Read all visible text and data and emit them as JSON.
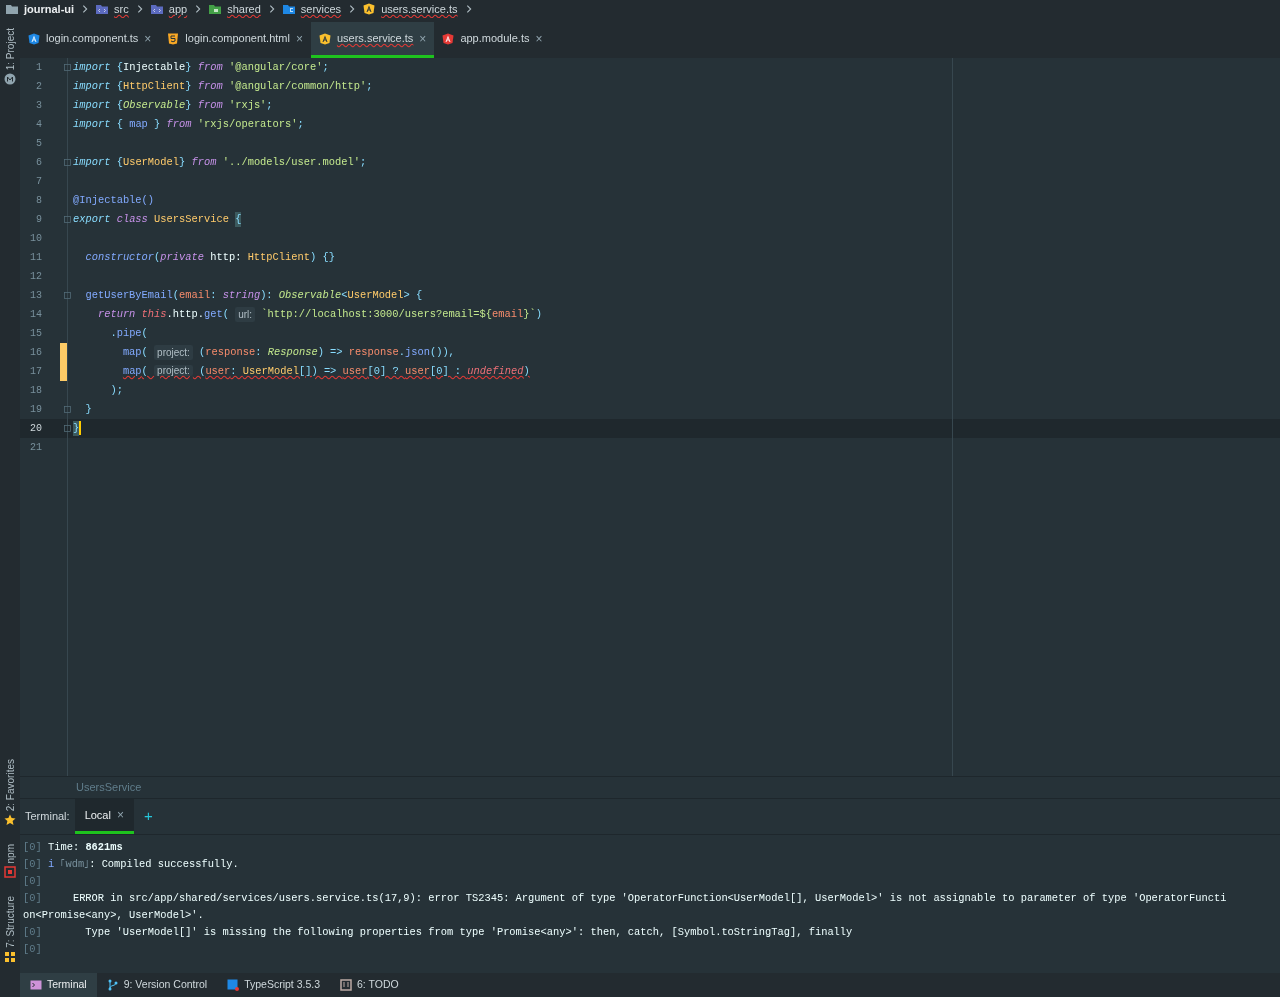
{
  "breadcrumb": [
    {
      "kind": "folder",
      "label": "journal-ui",
      "bold": true,
      "error": false
    },
    {
      "kind": "src-folder",
      "label": "src",
      "bold": false,
      "error": true
    },
    {
      "kind": "src-folder",
      "label": "app",
      "bold": false,
      "error": true
    },
    {
      "kind": "green-folder",
      "label": "shared",
      "bold": false,
      "error": true
    },
    {
      "kind": "blue-folder",
      "label": "services",
      "bold": false,
      "error": true
    },
    {
      "kind": "angular-yellow",
      "label": "users.service.ts",
      "bold": false,
      "error": true
    }
  ],
  "side_tools_top": [
    {
      "label": "1: Project",
      "kind": "project"
    }
  ],
  "side_tools_bottom": [
    {
      "label": "2: Favorites",
      "kind": "star"
    },
    {
      "label": "npm",
      "kind": "npm"
    },
    {
      "label": "7: Structure",
      "kind": "structure"
    }
  ],
  "tabs": [
    {
      "kind": "angular-blue",
      "label": "login.component.ts",
      "selected": false,
      "error": false
    },
    {
      "kind": "html",
      "label": "login.component.html",
      "selected": false,
      "error": false
    },
    {
      "kind": "angular-yellow",
      "label": "users.service.ts",
      "selected": true,
      "error": true
    },
    {
      "kind": "angular-red",
      "label": "app.module.ts",
      "selected": false,
      "error": false
    }
  ],
  "close_glyph": "×",
  "code": [
    {
      "number": "1",
      "fold": true,
      "changed": false,
      "current": false,
      "tokens": [
        {
          "text": "import",
          "kind": "kwb"
        },
        {
          "text": " {",
          "kind": "p"
        },
        {
          "text": "Injectable",
          "kind": "id"
        },
        {
          "text": "} ",
          "kind": "p"
        },
        {
          "text": "from",
          "kind": "kwp"
        },
        {
          "text": " '@angular/core'",
          "kind": "str"
        },
        {
          "text": ";",
          "kind": "p"
        }
      ]
    },
    {
      "number": "2",
      "fold": false,
      "changed": false,
      "current": false,
      "tokens": [
        {
          "text": "import",
          "kind": "kwb"
        },
        {
          "text": " {",
          "kind": "p"
        },
        {
          "text": "HttpClient",
          "kind": "cls"
        },
        {
          "text": "} ",
          "kind": "p"
        },
        {
          "text": "from",
          "kind": "kwp"
        },
        {
          "text": " '@angular/common/http'",
          "kind": "str"
        },
        {
          "text": ";",
          "kind": "p"
        }
      ]
    },
    {
      "number": "3",
      "fold": false,
      "changed": false,
      "current": false,
      "tokens": [
        {
          "text": "import",
          "kind": "kwb"
        },
        {
          "text": " {",
          "kind": "p"
        },
        {
          "text": "Observable",
          "kind": "iface"
        },
        {
          "text": "} ",
          "kind": "p"
        },
        {
          "text": "from",
          "kind": "kwp"
        },
        {
          "text": " 'rxjs'",
          "kind": "str"
        },
        {
          "text": ";",
          "kind": "p"
        }
      ]
    },
    {
      "number": "4",
      "fold": false,
      "changed": false,
      "current": false,
      "tokens": [
        {
          "text": "import",
          "kind": "kwb"
        },
        {
          "text": " { ",
          "kind": "p"
        },
        {
          "text": "map",
          "kind": "fn"
        },
        {
          "text": " } ",
          "kind": "p"
        },
        {
          "text": "from",
          "kind": "kwp"
        },
        {
          "text": " 'rxjs/operators'",
          "kind": "str"
        },
        {
          "text": ";",
          "kind": "p"
        }
      ]
    },
    {
      "number": "5",
      "fold": false,
      "changed": false,
      "current": false
    },
    {
      "number": "6",
      "fold": true,
      "changed": false,
      "current": false,
      "tokens": [
        {
          "text": "import",
          "kind": "kwb"
        },
        {
          "text": " {",
          "kind": "p"
        },
        {
          "text": "UserModel",
          "kind": "cls"
        },
        {
          "text": "} ",
          "kind": "p"
        },
        {
          "text": "from",
          "kind": "kwp"
        },
        {
          "text": " '../models/user.model'",
          "kind": "str"
        },
        {
          "text": ";",
          "kind": "p"
        }
      ]
    },
    {
      "number": "7",
      "fold": false,
      "changed": false,
      "current": false
    },
    {
      "number": "8",
      "fold": false,
      "changed": false,
      "current": false,
      "tokens": [
        {
          "text": "@Injectable()",
          "kind": "dec"
        }
      ]
    },
    {
      "number": "9",
      "fold": true,
      "changed": false,
      "current": false,
      "tokens": [
        {
          "text": "export ",
          "kind": "kwb"
        },
        {
          "text": "class ",
          "kind": "kwp"
        },
        {
          "text": "UsersService ",
          "kind": "cls"
        },
        {
          "text": "{",
          "kind": "brace"
        }
      ]
    },
    {
      "number": "10",
      "fold": false,
      "changed": false,
      "current": false
    },
    {
      "number": "11",
      "fold": false,
      "changed": false,
      "current": false,
      "tokens": [
        {
          "text": "  constructor",
          "kind": "fni"
        },
        {
          "text": "(",
          "kind": "p"
        },
        {
          "text": "private",
          "kind": "kwp"
        },
        {
          "text": " http: ",
          "kind": "id"
        },
        {
          "text": "HttpClient",
          "kind": "cls"
        },
        {
          "text": ") {}",
          "kind": "p"
        }
      ]
    },
    {
      "number": "12",
      "fold": false,
      "changed": false,
      "current": false
    },
    {
      "number": "13",
      "fold": true,
      "changed": false,
      "current": false,
      "tokens": [
        {
          "text": "  getUserByEmail",
          "kind": "fn"
        },
        {
          "text": "(",
          "kind": "p"
        },
        {
          "text": "email",
          "kind": "param"
        },
        {
          "text": ": ",
          "kind": "p"
        },
        {
          "text": "string",
          "kind": "kwp"
        },
        {
          "text": "): ",
          "kind": "p"
        },
        {
          "text": "Observable",
          "kind": "iface"
        },
        {
          "text": "<",
          "kind": "p"
        },
        {
          "text": "UserModel",
          "kind": "cls"
        },
        {
          "text": "> {",
          "kind": "p"
        }
      ]
    },
    {
      "number": "14",
      "fold": false,
      "changed": false,
      "current": false,
      "tokens": [
        {
          "text": "    return ",
          "kind": "kwp"
        },
        {
          "text": "this",
          "kind": "kwr"
        },
        {
          "text": ".http.",
          "kind": "id"
        },
        {
          "text": "get",
          "kind": "fn"
        },
        {
          "text": "( ",
          "kind": "p"
        },
        {
          "text": "url:",
          "kind": "hint"
        },
        {
          "text": " `http://localhost:3000/users?email=${",
          "kind": "str"
        },
        {
          "text": "email",
          "kind": "param"
        },
        {
          "text": "}`",
          "kind": "str"
        },
        {
          "text": ")",
          "kind": "p"
        }
      ]
    },
    {
      "number": "15",
      "fold": false,
      "changed": false,
      "current": false,
      "tokens": [
        {
          "text": "      .",
          "kind": "p"
        },
        {
          "text": "pipe",
          "kind": "fn"
        },
        {
          "text": "(",
          "kind": "p"
        }
      ]
    },
    {
      "number": "16",
      "fold": false,
      "changed": true,
      "current": false,
      "tokens": [
        {
          "text": "        map",
          "kind": "fn"
        },
        {
          "text": "( ",
          "kind": "p"
        },
        {
          "text": "project:",
          "kind": "hint"
        },
        {
          "text": " (",
          "kind": "p"
        },
        {
          "text": "response",
          "kind": "param"
        },
        {
          "text": ": ",
          "kind": "p"
        },
        {
          "text": "Response",
          "kind": "iface"
        },
        {
          "text": ") => ",
          "kind": "p"
        },
        {
          "text": "response",
          "kind": "param"
        },
        {
          "text": ".",
          "kind": "p"
        },
        {
          "text": "json",
          "kind": "fn"
        },
        {
          "text": "()),",
          "kind": "p"
        }
      ]
    },
    {
      "number": "17",
      "fold": false,
      "changed": true,
      "current": false,
      "error": true,
      "tokens": [
        {
          "text": "        map",
          "kind": "fn"
        },
        {
          "text": "( ",
          "kind": "p"
        },
        {
          "text": "project:",
          "kind": "hint"
        },
        {
          "text": " (",
          "kind": "p"
        },
        {
          "text": "user",
          "kind": "param"
        },
        {
          "text": ": ",
          "kind": "p"
        },
        {
          "text": "UserModel",
          "kind": "cls"
        },
        {
          "text": "[]) => ",
          "kind": "p"
        },
        {
          "text": "user",
          "kind": "param"
        },
        {
          "text": "[0] ? ",
          "kind": "p"
        },
        {
          "text": "user",
          "kind": "param"
        },
        {
          "text": "[0] : ",
          "kind": "p"
        },
        {
          "text": "undefined",
          "kind": "kwr"
        },
        {
          "text": ")",
          "kind": "p"
        }
      ]
    },
    {
      "number": "18",
      "fold": false,
      "changed": false,
      "current": false,
      "tokens": [
        {
          "text": "      );",
          "kind": "p"
        }
      ]
    },
    {
      "number": "19",
      "fold": true,
      "changed": false,
      "current": false,
      "tokens": [
        {
          "text": "  }",
          "kind": "p"
        }
      ]
    },
    {
      "number": "20",
      "fold": true,
      "changed": false,
      "current": true,
      "tokens": [
        {
          "text": "}",
          "kind": "brace"
        }
      ]
    },
    {
      "number": "21",
      "fold": false,
      "changed": false,
      "current": false
    }
  ],
  "editor_breadcrumb": "UsersService",
  "terminal": {
    "label": "Terminal:",
    "tabs": [
      {
        "label": "Local",
        "selected": true
      }
    ],
    "add": "+",
    "lines": [
      {
        "prefix": "[0]",
        "tokens": [
          {
            "text": " Time: ",
            "kind": "p"
          },
          {
            "text": "8621ms",
            "kind": "bold"
          }
        ]
      },
      {
        "prefix": "[0]",
        "tokens": [
          {
            "text": " i",
            "kind": "info"
          },
          {
            "text": " ｢wdm｣",
            "kind": "dim"
          },
          {
            "text": ": Compiled successfully.",
            "kind": "p"
          }
        ]
      },
      {
        "prefix": "[0]"
      },
      {
        "prefix": "[0]",
        "tokens": [
          {
            "text": "     ERROR in src/app/shared/services/users.service.ts(17,9): error TS2345: Argument of type 'OperatorFunction<UserModel[], UserModel>' is not assignable to parameter of type 'OperatorFuncti",
            "kind": "p"
          }
        ]
      },
      {
        "tokens": [
          {
            "text": "on<Promise<any>, UserModel>'.",
            "kind": "p"
          }
        ]
      },
      {
        "prefix": "[0]",
        "tokens": [
          {
            "text": "       Type 'UserModel[]' is missing the following properties from type 'Promise<any>': then, catch, [Symbol.toStringTag], finally",
            "kind": "p"
          }
        ]
      },
      {
        "prefix": "[0]"
      }
    ]
  },
  "bottom_tools": [
    {
      "kind": "terminal",
      "label": "Terminal",
      "selected": true
    },
    {
      "kind": "branch",
      "label": "9: Version Control",
      "selected": false
    },
    {
      "kind": "typescript",
      "label": "TypeScript 3.5.3",
      "selected": false
    },
    {
      "kind": "todo",
      "label": "6: TODO",
      "selected": false
    }
  ]
}
